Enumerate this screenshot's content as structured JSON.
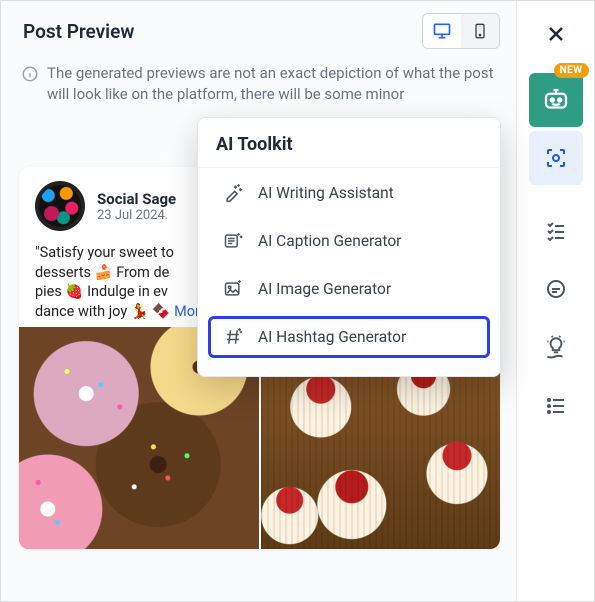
{
  "header": {
    "title": "Post Preview"
  },
  "notice": "The generated previews are not an exact depiction of what the post will look like on the platform, there will be some minor",
  "post": {
    "author": "Social Sage",
    "date": "23 Jul 2024.",
    "body_prefix": "\"Satisfy your sweet to",
    "body_line2": "desserts 🍰 From de",
    "body_line3": "pies 🍓 Indulge in ev",
    "body_line4": "dance with joy 💃 🍫",
    "see_more": "More"
  },
  "popover": {
    "title": "AI Toolkit",
    "items": [
      {
        "label": "AI Writing Assistant"
      },
      {
        "label": "AI Caption Generator"
      },
      {
        "label": "AI Image Generator"
      },
      {
        "label": "AI Hashtag Generator"
      }
    ]
  },
  "badge_new": "NEW"
}
